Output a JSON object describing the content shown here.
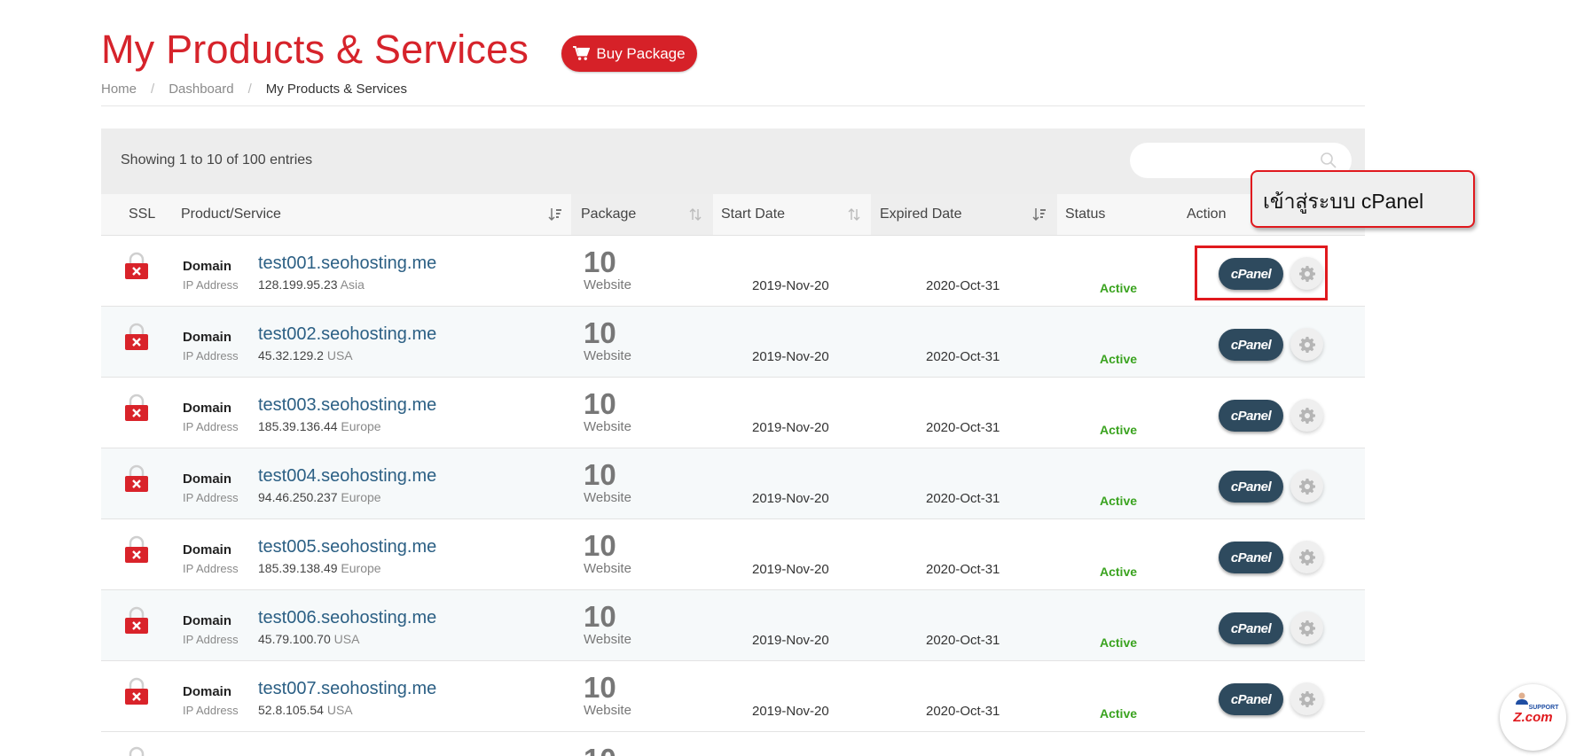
{
  "page": {
    "title": "My Products & Services",
    "buy_button": "Buy Package",
    "breadcrumb": [
      "Home",
      "Dashboard",
      "My Products & Services"
    ]
  },
  "table": {
    "entries_info": "Showing 1 to 10 of 100 entries",
    "search_placeholder": "",
    "columns": [
      "SSL",
      "Product/Service",
      "Package",
      "Start Date",
      "Expired Date",
      "Status",
      "Action"
    ],
    "rows": [
      {
        "type": "Domain",
        "ip_label": "IP Address",
        "domain": "test001.seohosting.me",
        "ip": "128.199.95.23",
        "region": "Asia",
        "pkg_num": "10",
        "pkg_unit": "Website",
        "start": "2019-Nov-20",
        "expire": "2020-Oct-31",
        "status": "Active",
        "cpanel": "cPanel"
      },
      {
        "type": "Domain",
        "ip_label": "IP Address",
        "domain": "test002.seohosting.me",
        "ip": "45.32.129.2",
        "region": "USA",
        "pkg_num": "10",
        "pkg_unit": "Website",
        "start": "2019-Nov-20",
        "expire": "2020-Oct-31",
        "status": "Active",
        "cpanel": "cPanel"
      },
      {
        "type": "Domain",
        "ip_label": "IP Address",
        "domain": "test003.seohosting.me",
        "ip": "185.39.136.44",
        "region": "Europe",
        "pkg_num": "10",
        "pkg_unit": "Website",
        "start": "2019-Nov-20",
        "expire": "2020-Oct-31",
        "status": "Active",
        "cpanel": "cPanel"
      },
      {
        "type": "Domain",
        "ip_label": "IP Address",
        "domain": "test004.seohosting.me",
        "ip": "94.46.250.237",
        "region": "Europe",
        "pkg_num": "10",
        "pkg_unit": "Website",
        "start": "2019-Nov-20",
        "expire": "2020-Oct-31",
        "status": "Active",
        "cpanel": "cPanel"
      },
      {
        "type": "Domain",
        "ip_label": "IP Address",
        "domain": "test005.seohosting.me",
        "ip": "185.39.138.49",
        "region": "Europe",
        "pkg_num": "10",
        "pkg_unit": "Website",
        "start": "2019-Nov-20",
        "expire": "2020-Oct-31",
        "status": "Active",
        "cpanel": "cPanel"
      },
      {
        "type": "Domain",
        "ip_label": "IP Address",
        "domain": "test006.seohosting.me",
        "ip": "45.79.100.70",
        "region": "USA",
        "pkg_num": "10",
        "pkg_unit": "Website",
        "start": "2019-Nov-20",
        "expire": "2020-Oct-31",
        "status": "Active",
        "cpanel": "cPanel"
      },
      {
        "type": "Domain",
        "ip_label": "IP Address",
        "domain": "test007.seohosting.me",
        "ip": "52.8.105.54",
        "region": "USA",
        "pkg_num": "10",
        "pkg_unit": "Website",
        "start": "2019-Nov-20",
        "expire": "2020-Oct-31",
        "status": "Active",
        "cpanel": "cPanel"
      }
    ],
    "partial_row": {
      "pkg_num": "10"
    }
  },
  "annotation": {
    "callout_text": "เข้าสู่ระบบ cPanel"
  },
  "support_badge": {
    "top": "SUPPORT",
    "brand": "Z.com"
  },
  "colors": {
    "brand_red": "#d6232b",
    "cpanel_navy": "#2e4a5e",
    "status_green": "#3aa31f",
    "link_blue": "#2b5f84"
  }
}
